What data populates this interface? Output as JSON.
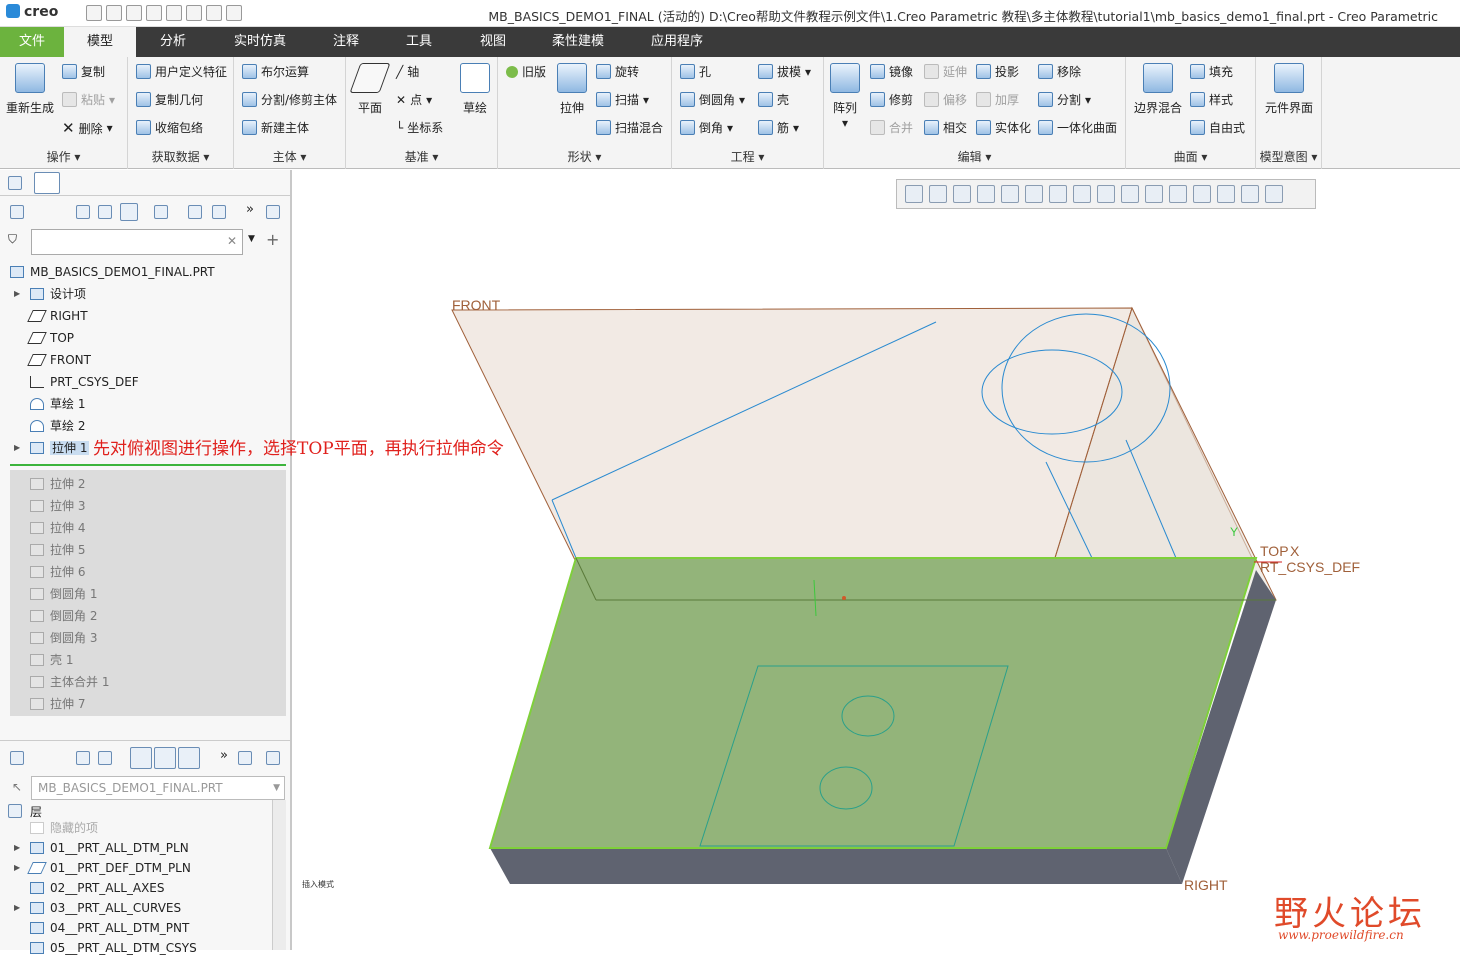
{
  "window": {
    "logo": "creo",
    "title": "MB_BASICS_DEMO1_FINAL (活动的) D:\\Creo帮助文件教程示例文件\\1.Creo Parametric 教程\\多主体教程\\tutorial1\\mb_basics_demo1_final.prt - Creo Parametric"
  },
  "menu": {
    "tabs": [
      "文件",
      "模型",
      "分析",
      "实时仿真",
      "注释",
      "工具",
      "视图",
      "柔性建模",
      "应用程序"
    ],
    "active": "模型"
  },
  "ribbon": {
    "operations": {
      "label": "操作",
      "regen": "重新生成",
      "copy": "复制",
      "paste": "粘贴",
      "delete": "删除"
    },
    "getdata": {
      "label": "获取数据",
      "udf": "用户定义特征",
      "copygeom": "复制几何",
      "shrinkwrap": "收缩包络"
    },
    "body": {
      "label": "主体",
      "boolean": "布尔运算",
      "split": "分割/修剪主体",
      "newbody": "新建主体"
    },
    "datum": {
      "label": "基准",
      "plane": "平面",
      "axis": "轴",
      "point": "点",
      "csys": "坐标系",
      "sketch": "草绘"
    },
    "shapes": {
      "label": "形状",
      "legacy": "旧版",
      "extrude": "拉伸",
      "revolve": "旋转",
      "sweep": "扫描",
      "sweptblend": "扫描混合"
    },
    "engineering": {
      "label": "工程",
      "hole": "孔",
      "round": "倒圆角",
      "chamfer": "倒角",
      "draft": "拔模",
      "shell": "壳",
      "rib": "筋"
    },
    "editing": {
      "label": "编辑",
      "pattern": "阵列",
      "mirror": "镜像",
      "trim": "修剪",
      "merge": "合并",
      "extend": "延伸",
      "offset": "偏移",
      "intersect": "相交",
      "project": "投影",
      "thicken": "加厚",
      "solidify": "实体化",
      "remove": "移除",
      "splitedit": "分割",
      "unify": "一体化曲面"
    },
    "surfaces": {
      "label": "曲面",
      "boundary": "边界混合",
      "fill": "填充",
      "style": "样式",
      "freestyle": "自由式"
    },
    "intent": {
      "label": "模型意图",
      "component": "元件界面"
    }
  },
  "tree": {
    "root": "MB_BASICS_DEMO1_FINAL.PRT",
    "items": [
      "设计项",
      "RIGHT",
      "TOP",
      "FRONT",
      "PRT_CSYS_DEF",
      "草绘 1",
      "草绘 2",
      "拉伸 1"
    ],
    "suppressed": [
      "拉伸 2",
      "拉伸 3",
      "拉伸 4",
      "拉伸 5",
      "拉伸 6",
      "倒圆角 1",
      "倒圆角 2",
      "倒圆角 3",
      "壳 1",
      "主体合并 1",
      "拉伸 7"
    ]
  },
  "layers": {
    "model": "MB_BASICS_DEMO1_FINAL.PRT",
    "header": "层",
    "items": [
      "隐藏的项",
      "01__PRT_ALL_DTM_PLN",
      "01__PRT_DEF_DTM_PLN",
      "02__PRT_ALL_AXES",
      "03__PRT_ALL_CURVES",
      "04__PRT_ALL_DTM_PNT",
      "05__PRT_ALL_DTM_CSYS"
    ]
  },
  "viewport": {
    "labels": {
      "front": "FRONT",
      "top": "TOP",
      "x": "X",
      "csys": "RT_CSYS_DEF",
      "right": "RIGHT",
      "y": "Y"
    },
    "status": "插入模式",
    "annotation": "先对俯视图进行操作，选择TOP平面，再执行拉伸命令",
    "watermark": "野火论坛",
    "watermark_url": "www.proewildfire.cn"
  },
  "colors": {
    "menubar": "#3a3a3a",
    "file_tab": "#6cb33e",
    "annotation": "#e0201c",
    "selected_face": "#93b47a",
    "part_side": "#5f6370"
  }
}
